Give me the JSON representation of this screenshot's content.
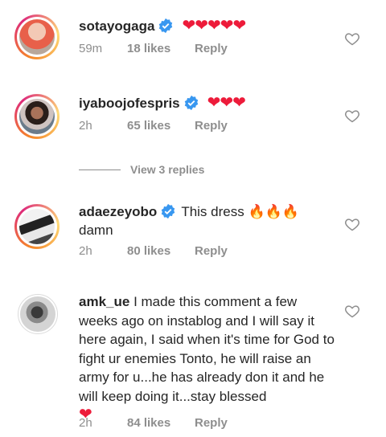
{
  "comments": [
    {
      "username": "sotayogaga",
      "text": "",
      "emojis": "❤❤❤❤❤",
      "time": "59m",
      "likes": "18 likes",
      "reply": "Reply"
    },
    {
      "username": "iyaboojofespris",
      "text": "",
      "emojis": "❤❤❤",
      "time": "2h",
      "likes": "65 likes",
      "reply": "Reply"
    },
    {
      "username": "adaezeyobo",
      "text": "This dress",
      "emojis": "🔥🔥🔥",
      "text2": "damn",
      "time": "2h",
      "likes": "80 likes",
      "reply": "Reply"
    },
    {
      "username": "amk_ue",
      "text": "I made this comment a few weeks ago on instablog and I will say it here again, I said when it's time for God to fight ur enemies Tonto, he will raise an army for u...he has already don it and he will keep doing it...stay blessed",
      "emojis": "❤",
      "time": "2h",
      "likes": "84 likes",
      "reply": "Reply"
    }
  ],
  "view_replies": "View 3 replies",
  "colors": {
    "heart": "#ed1b3a",
    "verified": "#3897f0",
    "meta": "#8e8e8e"
  },
  "icons": {
    "verified": "verified-badge-icon",
    "like": "heart-outline-icon"
  }
}
